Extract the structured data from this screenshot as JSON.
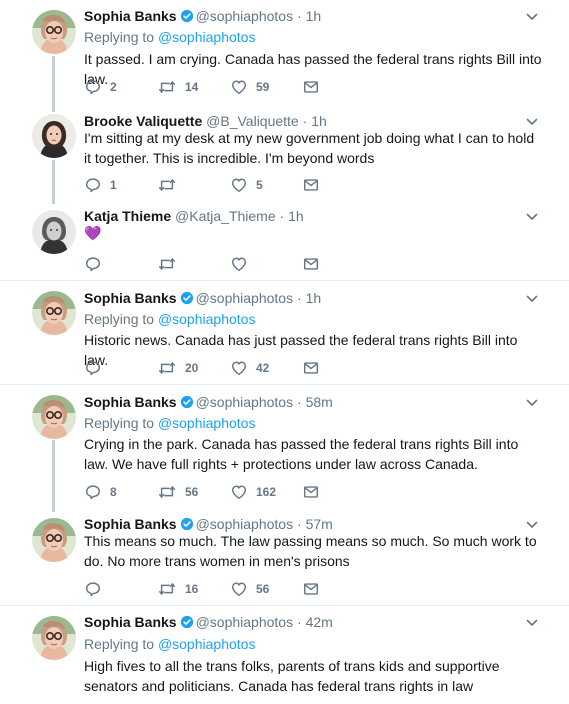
{
  "tweets": [
    {
      "name": "Sophia Banks",
      "handle": "@sophiaphotos",
      "time": "1h",
      "verified": true,
      "replying_label": "Replying to",
      "replying_to": "@sophiaphotos",
      "text": "It passed. I am crying. Canada has passed the federal trans rights Bill into law.",
      "replies": "2",
      "retweets": "14",
      "likes": "59",
      "avatar": "sophia"
    },
    {
      "name": "Brooke Valiquette",
      "handle": "@B_Valiquette",
      "time": "1h",
      "verified": false,
      "text": "I'm sitting at my desk at my new government job doing what I can to hold it together. This is incredible. I'm beyond words",
      "replies": "1",
      "retweets": "",
      "likes": "5",
      "avatar": "brooke"
    },
    {
      "name": "Katja Thieme",
      "handle": "@Katja_Thieme",
      "time": "1h",
      "verified": false,
      "text": "💜",
      "replies": "",
      "retweets": "",
      "likes": "",
      "avatar": "katja"
    },
    {
      "name": "Sophia Banks",
      "handle": "@sophiaphotos",
      "time": "1h",
      "verified": true,
      "replying_label": "Replying to",
      "replying_to": "@sophiaphotos",
      "text": "Historic news. Canada has just passed the federal trans rights Bill into law.",
      "replies": "",
      "retweets": "20",
      "likes": "42",
      "avatar": "sophia"
    },
    {
      "name": "Sophia Banks",
      "handle": "@sophiaphotos",
      "time": "58m",
      "verified": true,
      "replying_label": "Replying to",
      "replying_to": "@sophiaphotos",
      "text": "Crying in the park. Canada has passed the federal trans rights Bill into law. We have full rights + protections under law across Canada.",
      "replies": "8",
      "retweets": "56",
      "likes": "162",
      "avatar": "sophia"
    },
    {
      "name": "Sophia Banks",
      "handle": "@sophiaphotos",
      "time": "57m",
      "verified": true,
      "text": "This means so much. The law passing means so much. So much work to do. No more trans women in men's prisons",
      "replies": "",
      "retweets": "16",
      "likes": "56",
      "avatar": "sophia"
    },
    {
      "name": "Sophia Banks",
      "handle": "@sophiaphotos",
      "time": "42m",
      "verified": true,
      "replying_label": "Replying to",
      "replying_to": "@sophiaphotos",
      "text": "High fives to all the trans folks, parents of trans kids and supportive senators and politicians. Canada has federal trans rights in law",
      "avatar": "sophia"
    }
  ],
  "colors": {
    "link": "#1da1f2",
    "muted": "#657786",
    "thread": "#c4cfd6"
  },
  "icons": [
    "reply-icon",
    "retweet-icon",
    "like-icon",
    "dm-icon",
    "verified-icon",
    "chevron-down-icon"
  ]
}
